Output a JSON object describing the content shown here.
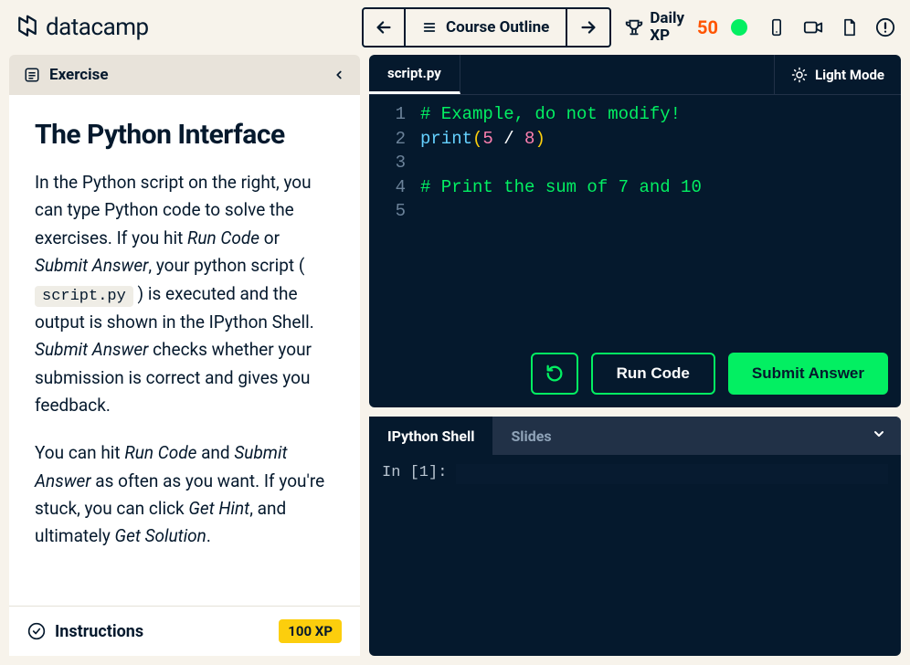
{
  "brand": "datacamp",
  "header": {
    "course_outline": "Course Outline",
    "daily_xp_label": "Daily\nXP",
    "daily_xp_value": "50"
  },
  "exercise": {
    "header": "Exercise",
    "title": "The Python Interface",
    "para1_a": "In the Python script on the right, you can type Python code to solve the exercises. If you hit ",
    "para1_run": "Run Code",
    "para1_b": " or ",
    "para1_submit": "Submit Answer",
    "para1_c": ", your python script ( ",
    "para1_code": "script.py",
    "para1_d": " ) is executed and the output is shown in the IPython Shell. ",
    "para1_submit2": "Submit Answer",
    "para1_e": " checks whether your submission is correct and gives you feedback.",
    "para2_a": "You can hit ",
    "para2_run": "Run Code",
    "para2_b": " and ",
    "para2_submit": "Submit Answer",
    "para2_c": " as often as you want. If you're stuck, you can click ",
    "para2_hint": "Get Hint",
    "para2_d": ", and ultimately ",
    "para2_sol": "Get Solution",
    "para2_e": "."
  },
  "instructions": {
    "label": "Instructions",
    "xp": "100 XP"
  },
  "editor": {
    "filename": "script.py",
    "light_mode": "Light Mode",
    "gutter": [
      "1",
      "2",
      "3",
      "4",
      "5"
    ],
    "line1_comment": "# Example, do not modify!",
    "line2_fn": "print",
    "line2_n1": "5",
    "line2_op": " / ",
    "line2_n2": "8",
    "line4_comment": "# Print the sum of 7 and 10",
    "run": "Run Code",
    "submit": "Submit Answer"
  },
  "shell": {
    "tab1": "IPython Shell",
    "tab2": "Slides",
    "prompt": "In [1]:"
  }
}
